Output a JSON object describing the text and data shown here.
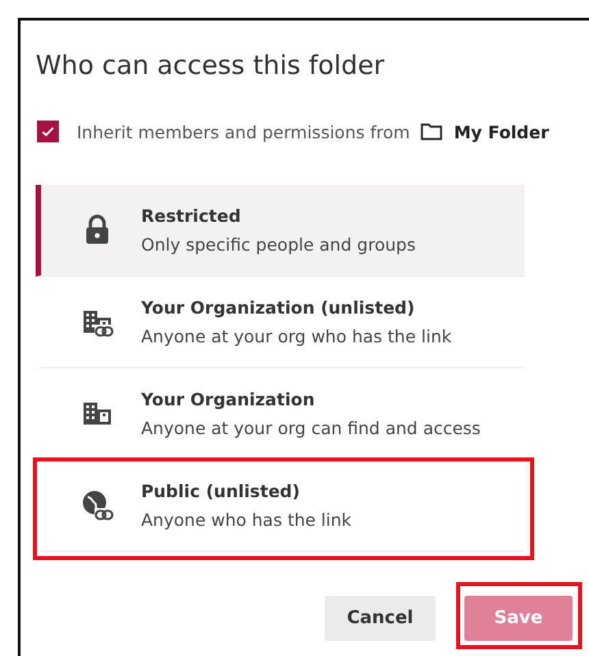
{
  "dialog": {
    "title": "Who can access this folder"
  },
  "inherit": {
    "checked": true,
    "label": "Inherit members and permissions from",
    "folder": "My Folder"
  },
  "options": [
    {
      "kind": "lock",
      "title": "Restricted",
      "description": "Only specific people and groups",
      "selected": true,
      "highlighted": false
    },
    {
      "kind": "org_link",
      "title": "Your Organization (unlisted)",
      "description": "Anyone at your org who has the link",
      "selected": false,
      "highlighted": false
    },
    {
      "kind": "org",
      "title": "Your Organization",
      "description": "Anyone at your org can find and access",
      "selected": false,
      "highlighted": false
    },
    {
      "kind": "globe_link",
      "title": "Public (unlisted)",
      "description": "Anyone who has the link",
      "selected": false,
      "highlighted": true
    }
  ],
  "buttons": [
    {
      "kind": "secondary",
      "label": "Cancel",
      "disabled": false,
      "highlighted": false
    },
    {
      "kind": "primary",
      "label": "Save",
      "disabled": true,
      "highlighted": true
    }
  ]
}
